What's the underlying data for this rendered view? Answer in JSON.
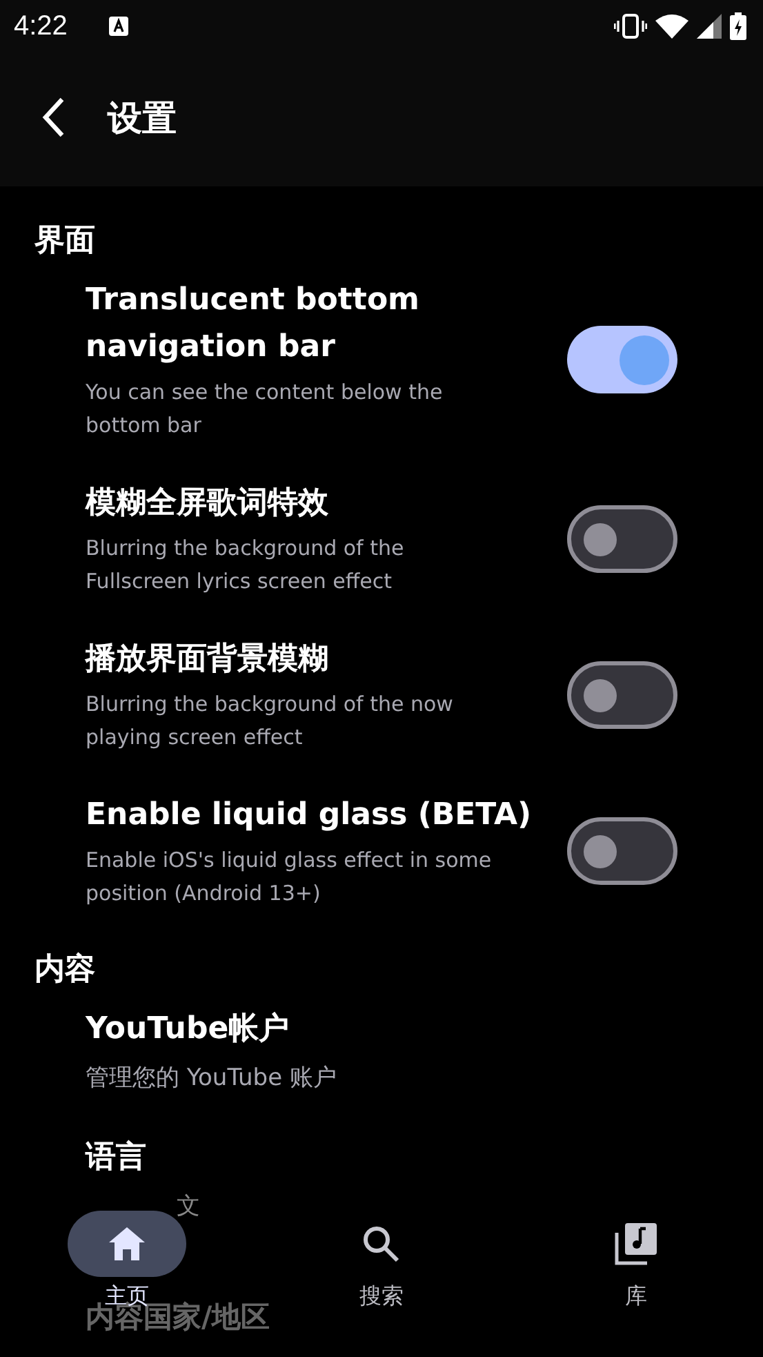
{
  "status_bar": {
    "time": "4:22"
  },
  "header": {
    "title": "设置"
  },
  "sections": [
    {
      "title": "界面",
      "items": [
        {
          "kind": "switch",
          "title": "Translucent bottom navigation bar",
          "subtitle": "You can see the content below the bottom bar",
          "on": true
        },
        {
          "kind": "switch",
          "title": "模糊全屏歌词特效",
          "subtitle": "Blurring the background of the Fullscreen lyrics screen effect",
          "on": false
        },
        {
          "kind": "switch",
          "title": "播放界面背景模糊",
          "subtitle": "Blurring the background of the now playing screen effect",
          "on": false
        },
        {
          "kind": "switch",
          "title": "Enable liquid glass (BETA)",
          "subtitle": "Enable iOS's liquid glass effect in some position (Android 13+)",
          "on": false
        }
      ]
    },
    {
      "title": "内容",
      "items": [
        {
          "kind": "link",
          "title": "YouTube帐户",
          "subtitle": "管理您的 YouTube 账户"
        },
        {
          "kind": "partial",
          "title": "语言",
          "subtitle": "文"
        },
        {
          "kind": "covered",
          "title": "内容国家/地区"
        }
      ]
    }
  ],
  "bottom_nav": [
    {
      "label": "主页",
      "kind": "home",
      "selected": true
    },
    {
      "label": "搜索",
      "kind": "search",
      "selected": false
    },
    {
      "label": "库",
      "kind": "library",
      "selected": false
    }
  ]
}
